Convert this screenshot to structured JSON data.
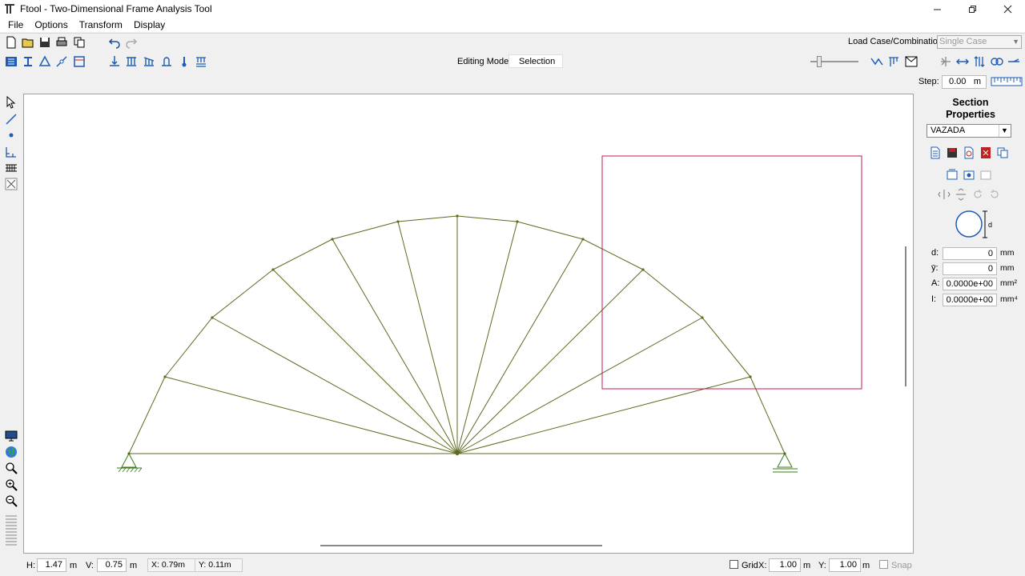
{
  "window": {
    "title": "Ftool - Two-Dimensional Frame Analysis Tool",
    "icon": "ftool-logo-icon",
    "controls": [
      "minimize-icon",
      "restore-icon",
      "close-icon"
    ]
  },
  "menu": {
    "items": [
      "File",
      "Options",
      "Transform",
      "Display"
    ]
  },
  "toolbar": {
    "load_case_label": "Load Case/Combination:",
    "load_case_value": "Single Case",
    "editing_mode_label": "Editing Mode:",
    "editing_mode_value": "Selection",
    "step_label": "Step:",
    "step_value": "0.00",
    "step_unit": "m"
  },
  "section_panel": {
    "title_line1": "Section",
    "title_line2": "Properties",
    "selected_section": "VAZADA",
    "diagram_label": "d",
    "properties": [
      {
        "label": "d:",
        "value": "0",
        "unit": "mm"
      },
      {
        "label": "ȳ:",
        "value": "0",
        "unit": "mm"
      },
      {
        "label": "A:",
        "value": "0.0000e+00",
        "unit": "mm²"
      },
      {
        "label": "I:",
        "value": "0.0000e+00",
        "unit": "mm⁴"
      }
    ]
  },
  "status": {
    "h_label": "H:",
    "h_value": "1.47",
    "h_unit": "m",
    "v_label": "V:",
    "v_value": "0.75",
    "v_unit": "m",
    "x_readout": "X: 0.79m",
    "y_readout": "Y: 0.11m",
    "grid_label": "Grid",
    "grid_x_label": "X:",
    "grid_x_value": "1.00",
    "grid_x_unit": "m",
    "grid_y_label": "Y:",
    "grid_y_value": "1.00",
    "grid_y_unit": "m",
    "snap_label": "Snap"
  },
  "colors": {
    "member": "#5c6b1e",
    "selection_box": "#c2185b",
    "support": "#3a7a1a"
  }
}
